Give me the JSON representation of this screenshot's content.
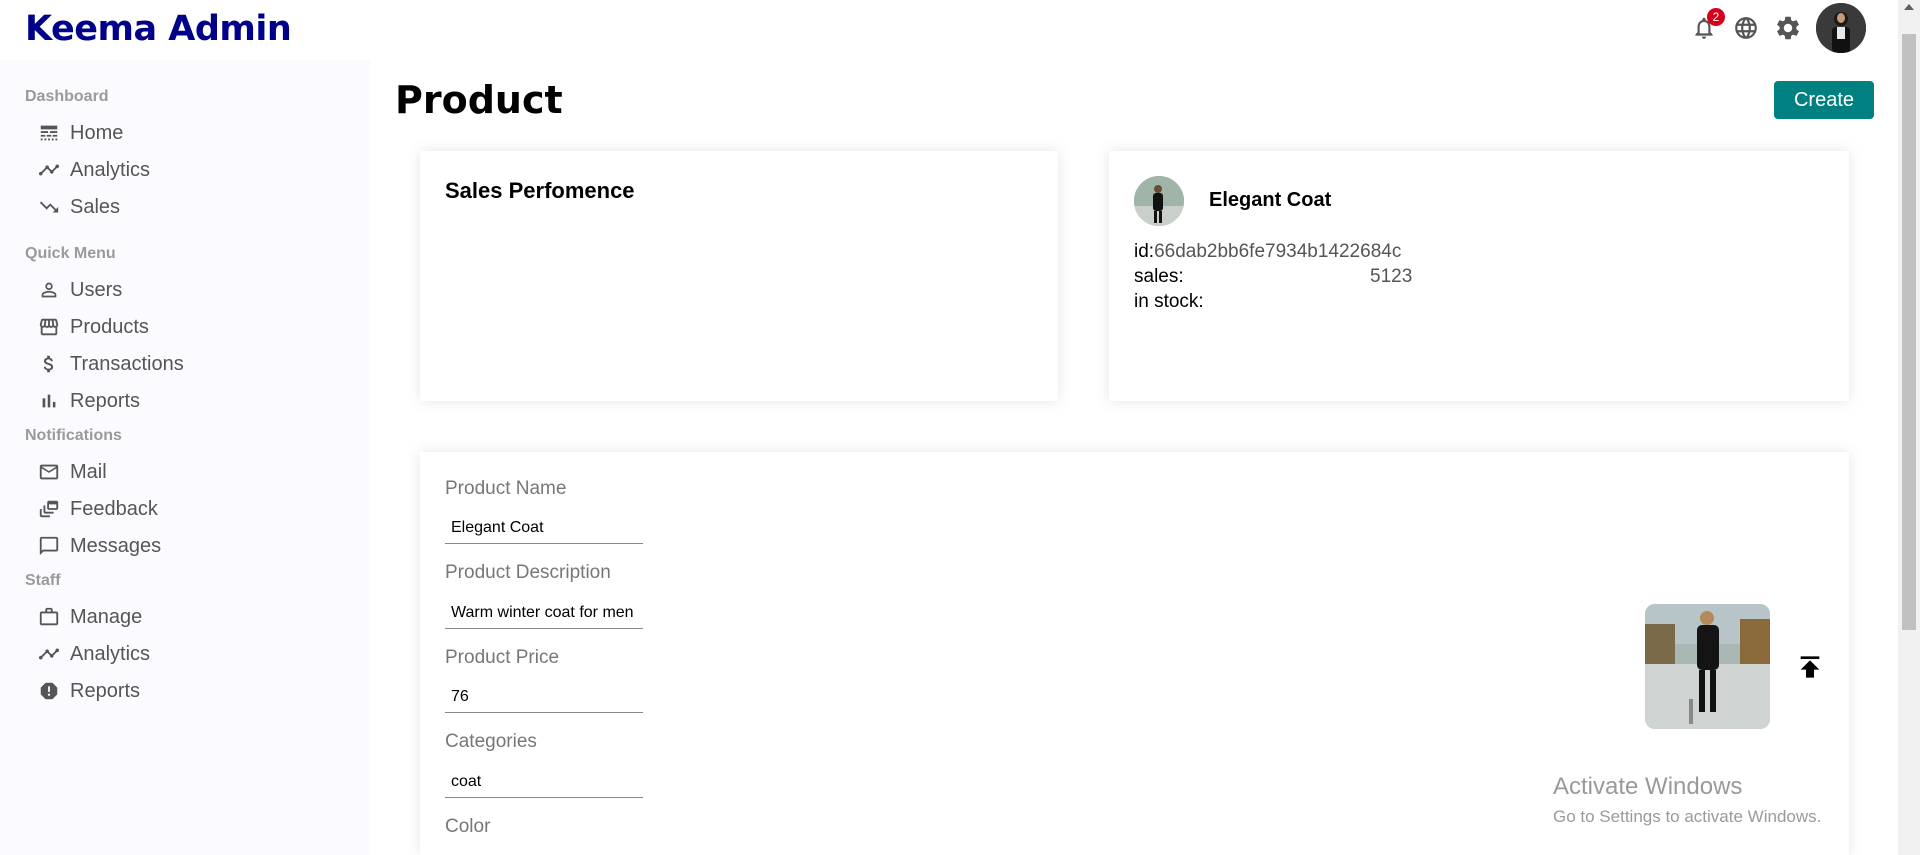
{
  "app": {
    "logo": "Keema Admin"
  },
  "topbar": {
    "notification_count": "2",
    "icons": [
      "bell-icon",
      "globe-icon",
      "gear-icon",
      "avatar"
    ]
  },
  "sidebar": {
    "sections": [
      {
        "title": "Dashboard",
        "items": [
          {
            "label": "Home",
            "icon": "line-style-icon"
          },
          {
            "label": "Analytics",
            "icon": "timeline-icon"
          },
          {
            "label": "Sales",
            "icon": "trending-down-icon"
          }
        ]
      },
      {
        "title": "Quick Menu",
        "items": [
          {
            "label": "Users",
            "icon": "person-icon"
          },
          {
            "label": "Products",
            "icon": "storefront-icon"
          },
          {
            "label": "Transactions",
            "icon": "dollar-icon"
          },
          {
            "label": "Reports",
            "icon": "bar-chart-icon"
          }
        ]
      },
      {
        "title": "Notifications",
        "items": [
          {
            "label": "Mail",
            "icon": "mail-icon"
          },
          {
            "label": "Feedback",
            "icon": "dynamic-feed-icon"
          },
          {
            "label": "Messages",
            "icon": "chat-bubble-icon"
          }
        ]
      },
      {
        "title": "Staff",
        "items": [
          {
            "label": "Manage",
            "icon": "briefcase-icon"
          },
          {
            "label": "Analytics",
            "icon": "timeline-icon"
          },
          {
            "label": "Reports",
            "icon": "report-icon"
          }
        ]
      }
    ]
  },
  "main": {
    "title": "Product",
    "create_label": "Create",
    "performance": {
      "title": "Sales Perfomence"
    },
    "product_info": {
      "name": "Elegant Coat",
      "id_label": "id:",
      "id_value": "66dab2bb6fe7934b1422684c",
      "sales_label": "sales:",
      "sales_value": "5123",
      "stock_label": "in stock:",
      "stock_value": ""
    },
    "form": {
      "name_label": "Product Name",
      "name_value": "Elegant Coat",
      "description_label": "Product Description",
      "description_value": "Warm winter coat for men",
      "price_label": "Product Price",
      "price_value": "76",
      "categories_label": "Categories",
      "categories_value": "coat",
      "color_label": "Color"
    }
  },
  "watermark": {
    "line1": "Activate Windows",
    "line2": "Go to Settings to activate Windows."
  },
  "colors": {
    "logo": "#00008b",
    "create_button": "#008080",
    "badge": "#d6001c",
    "sidebar_bg": "#fbfbff"
  }
}
